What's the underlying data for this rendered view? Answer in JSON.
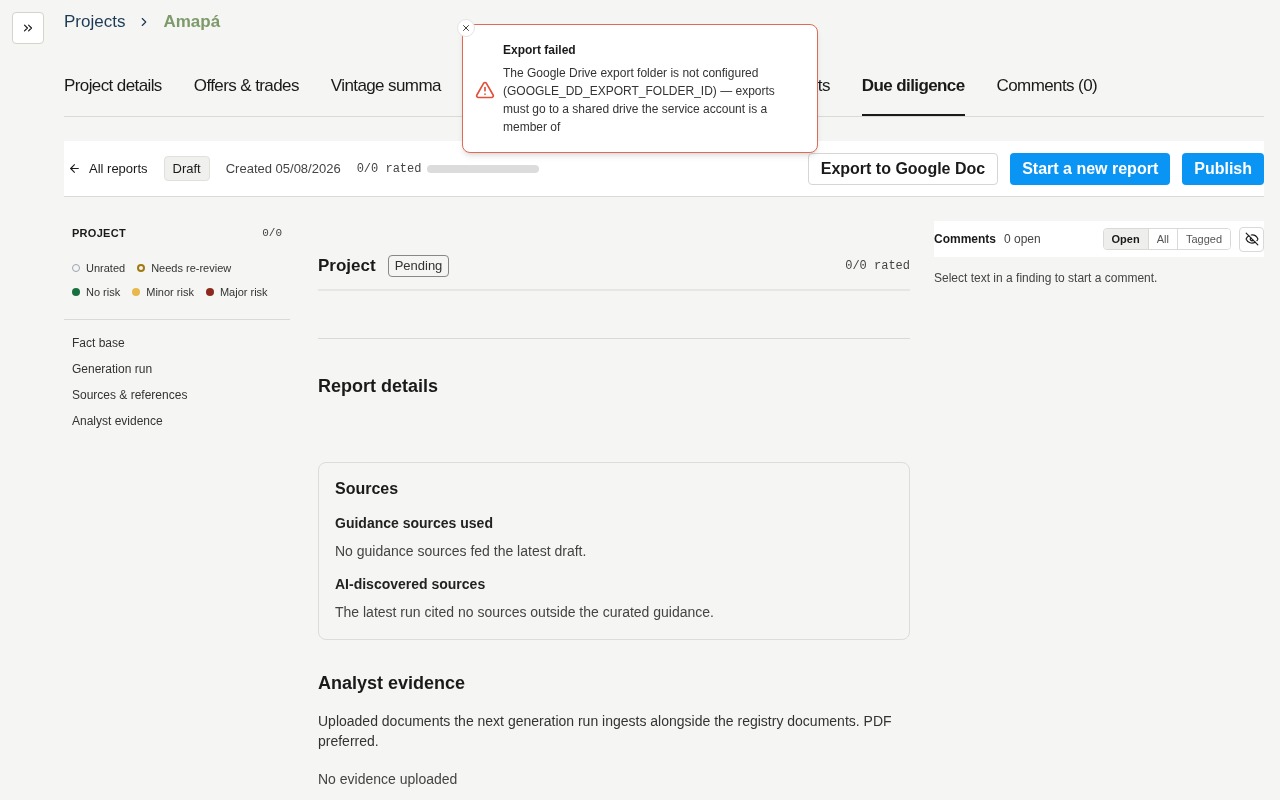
{
  "breadcrumb": [
    {
      "label": "Projects",
      "current": false
    },
    {
      "label": "Amapá",
      "current": true
    }
  ],
  "tabs": [
    {
      "label": "Project details",
      "selected": false
    },
    {
      "label": "Offers & trades",
      "selected": false
    },
    {
      "label": "Vintage summa",
      "selected": false
    },
    {
      "label": "ts",
      "selected": false
    },
    {
      "label": "Due diligence",
      "selected": true
    },
    {
      "label": "Comments (0)",
      "selected": false
    }
  ],
  "toast": {
    "title": "Export failed",
    "message": "The Google Drive export folder is not configured (GOOGLE_DD_EXPORT_FOLDER_ID) — exports must go to a shared drive the service account is a member of"
  },
  "toolbar": {
    "back": "All reports",
    "status": "Draft",
    "created": "Created 05/08/2026",
    "rated": "0/0 rated",
    "progress": {
      "level": 0
    },
    "buttons": [
      {
        "label": "Export to Google Doc",
        "kind": "outline"
      },
      {
        "label": "Start a new report",
        "kind": "primary"
      },
      {
        "label": "Publish",
        "kind": "primary"
      }
    ]
  },
  "sidebar": {
    "title": "PROJECT",
    "count": "0/0",
    "legend": [
      {
        "label": "Unrated",
        "kind": "ring",
        "color": "#9ca3af"
      },
      {
        "label": "Needs re-review",
        "kind": "ring",
        "color": "#a07a10"
      },
      {
        "label": "No risk",
        "kind": "dot",
        "color": "#17703f"
      },
      {
        "label": "Minor risk",
        "kind": "dot",
        "color": "#e8b84a"
      },
      {
        "label": "Major risk",
        "kind": "dot",
        "color": "#8b2a1c"
      }
    ],
    "items": [
      "Fact base",
      "Generation run",
      "Sources & references",
      "Analyst evidence"
    ]
  },
  "main": {
    "section": {
      "title": "Project",
      "badge": "Pending",
      "rated": "0/0 rated"
    },
    "report_details": "Report details",
    "sources": {
      "title": "Sources",
      "groups": [
        {
          "heading": "Guidance sources used",
          "text": "No guidance sources fed the latest draft."
        },
        {
          "heading": "AI-discovered sources",
          "text": "The latest run cited no sources outside the curated guidance."
        }
      ]
    },
    "evidence": {
      "title": "Analyst evidence",
      "description": "Uploaded documents the next generation run ingests alongside the registry documents. PDF preferred.",
      "empty": "No evidence uploaded"
    }
  },
  "comments": {
    "title": "Comments",
    "count": "0 open",
    "filters": [
      {
        "label": "Open",
        "selected": true
      },
      {
        "label": "All",
        "selected": false
      },
      {
        "label": "Tagged",
        "selected": false
      }
    ],
    "hint": "Select text in a finding to start a comment."
  }
}
